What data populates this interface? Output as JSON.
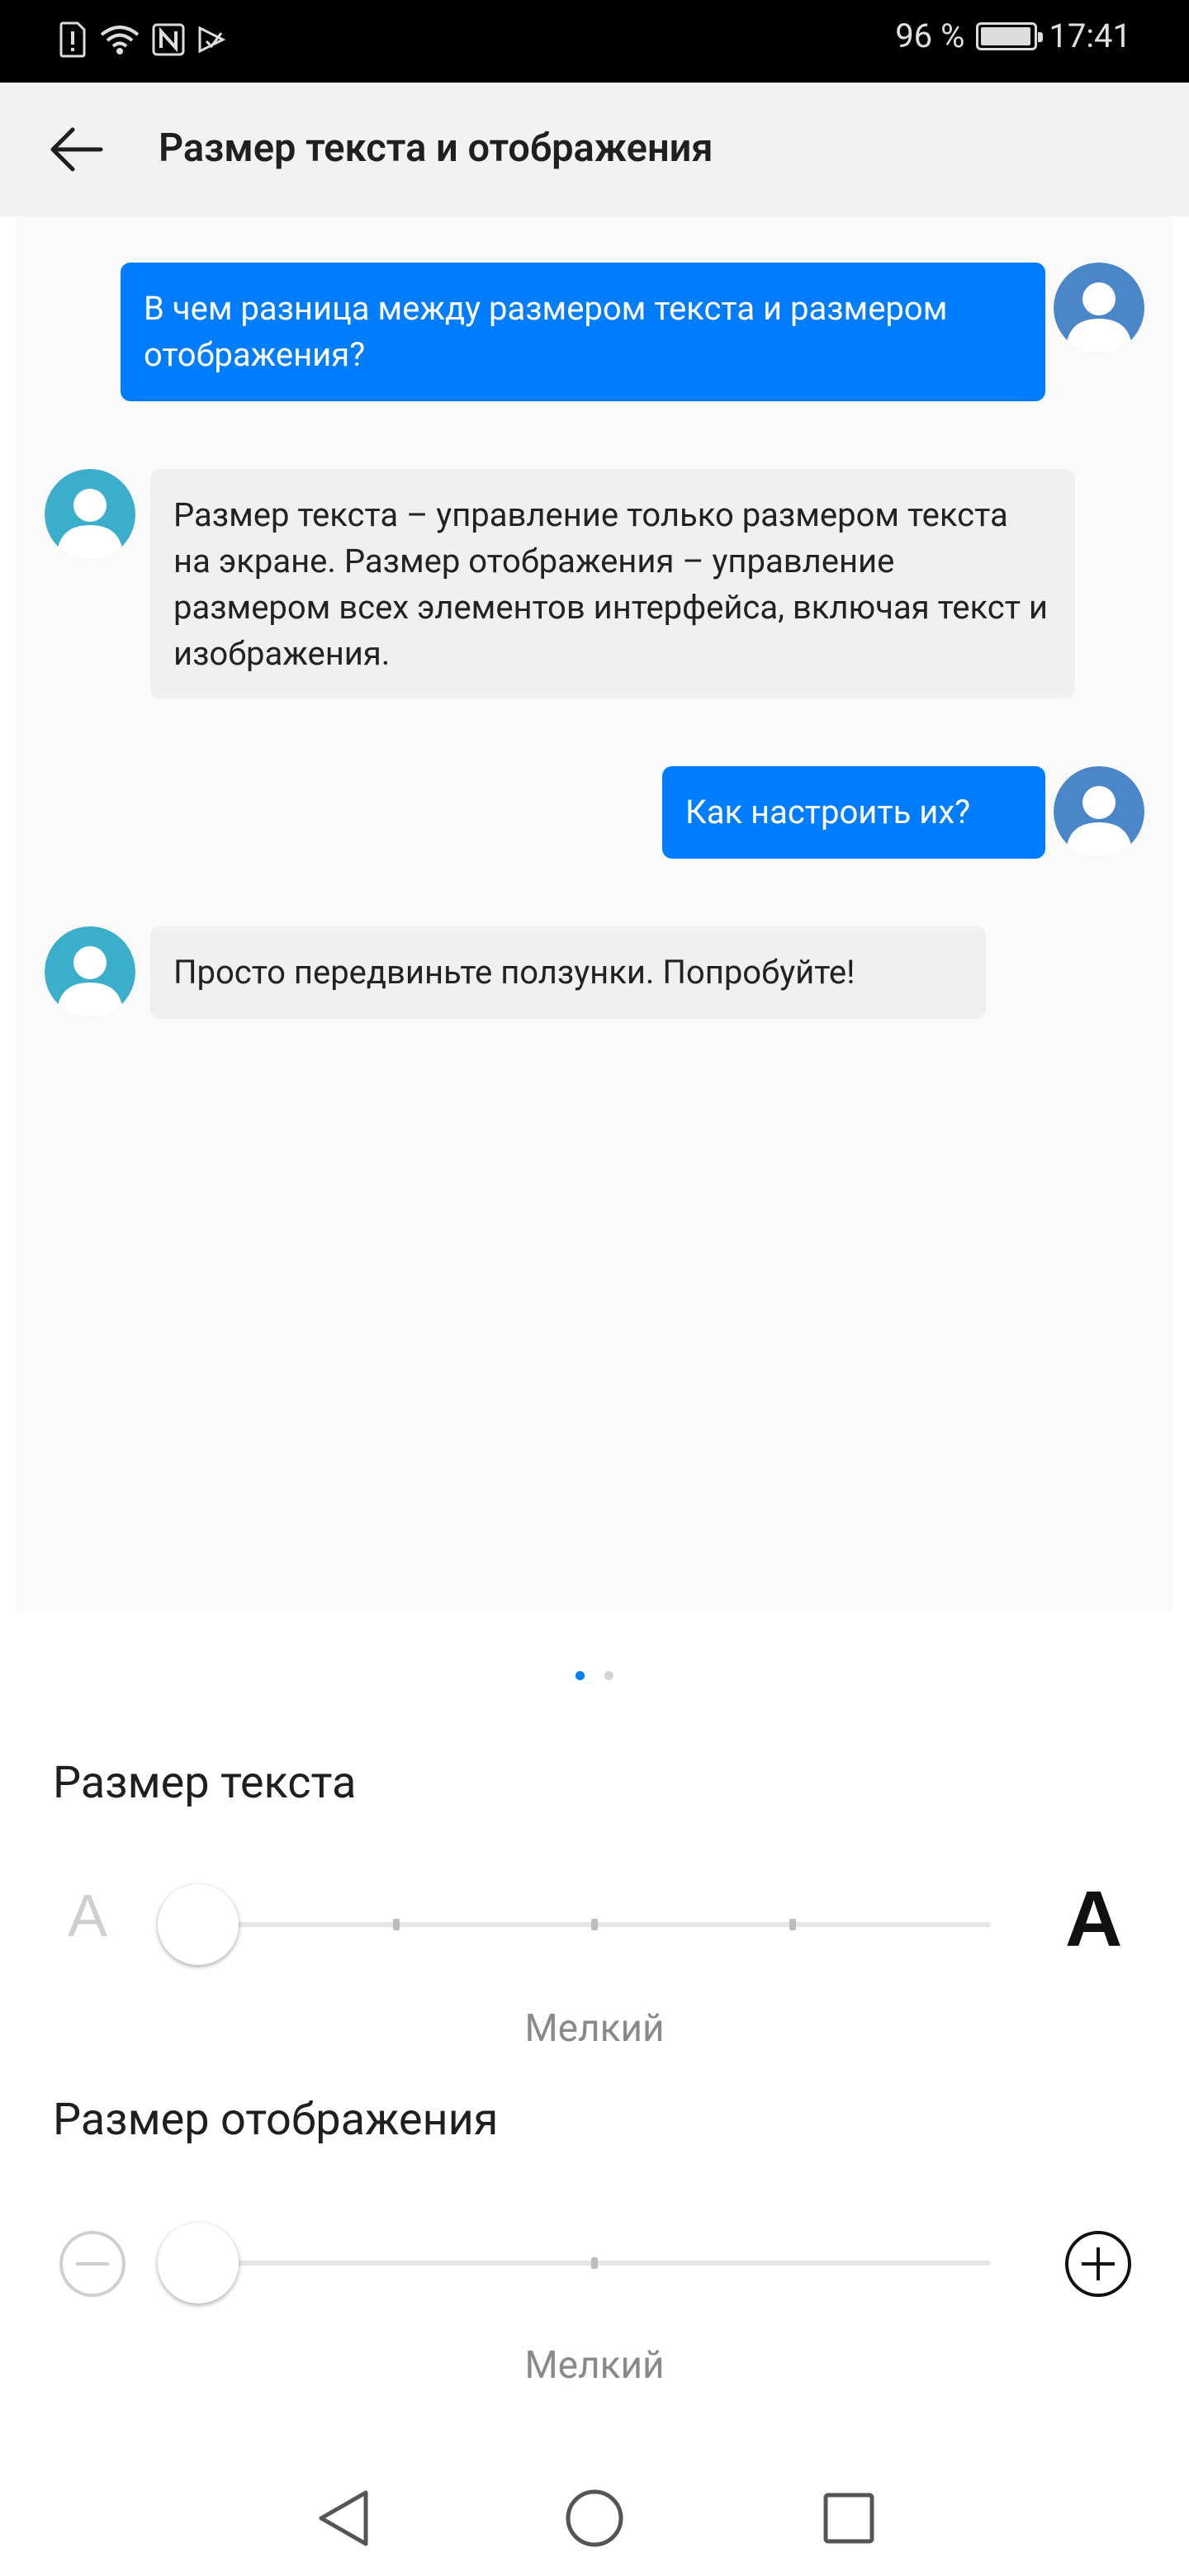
{
  "status_bar": {
    "battery_percent_label": "96 %",
    "battery_level": 0.96,
    "time": "17:41"
  },
  "header": {
    "title": "Размер текста и отображения"
  },
  "chat": {
    "messages": [
      {
        "side": "out",
        "text": "В чем разница между размером текста и размером отображения?"
      },
      {
        "side": "in",
        "text": "Размер текста – управление только размером текста на экране. Размер отображения – управление размером всех элементов интерфейса, включая текст и изображения."
      },
      {
        "side": "out",
        "text": "Как настроить их?"
      },
      {
        "side": "in",
        "text": "Просто передвиньте ползунки. Попробуйте!"
      }
    ]
  },
  "text_size": {
    "title": "Размер текста",
    "small_glyph": "A",
    "large_glyph": "A",
    "value_label": "Мелкий",
    "steps": 5,
    "current_step": 0
  },
  "display_size": {
    "title": "Размер отображения",
    "value_label": "Мелкий",
    "steps": 3,
    "current_step": 0
  },
  "colors": {
    "accent": "#007dff",
    "bubble_in": "#f0f0f0",
    "avatar_out": "#4a86c8",
    "avatar_in": "#3aaecb"
  }
}
